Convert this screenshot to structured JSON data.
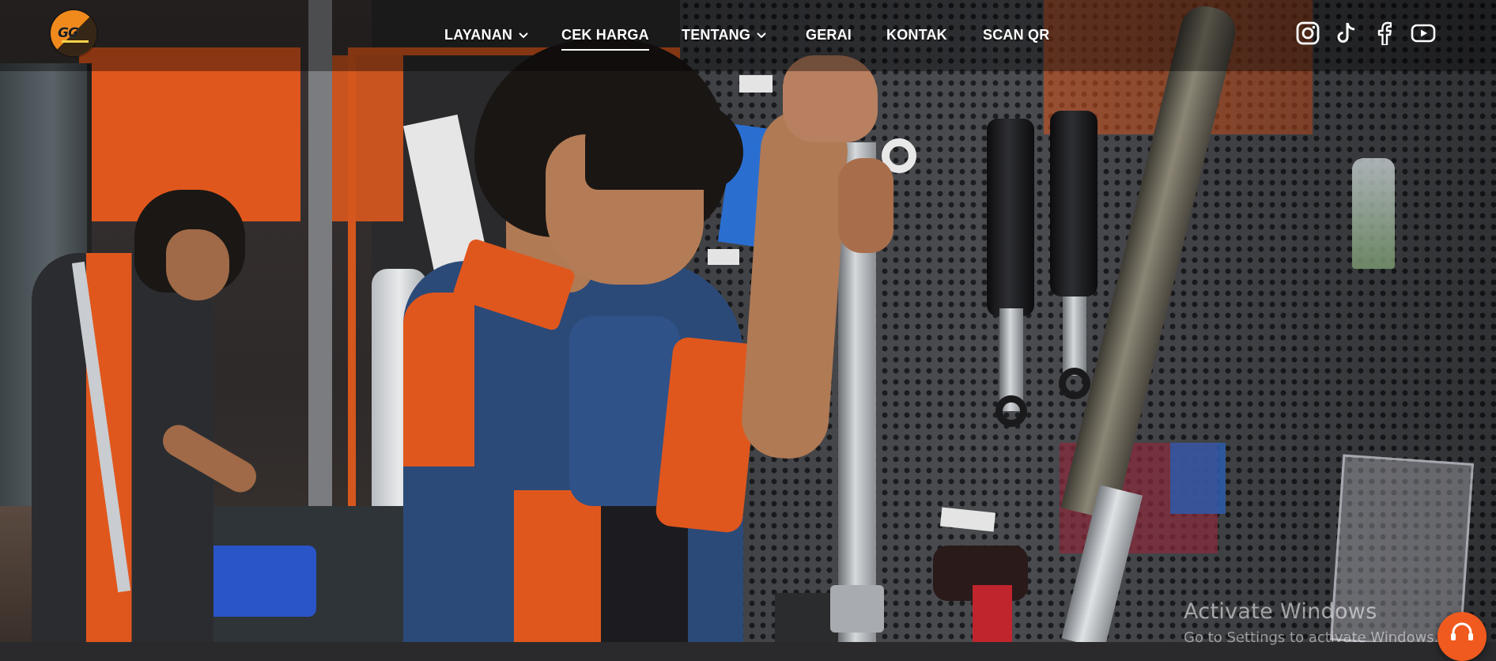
{
  "brand": {
    "logo_text": "GG",
    "logo_colors": {
      "primary": "#f08a1c",
      "secondary": "#1b1b1b"
    }
  },
  "nav": {
    "items": [
      {
        "label": "LAYANAN",
        "has_dropdown": true
      },
      {
        "label": "CEK HARGA",
        "has_dropdown": false,
        "active": true
      },
      {
        "label": "TENTANG",
        "has_dropdown": true
      },
      {
        "label": "GERAI",
        "has_dropdown": false
      },
      {
        "label": "KONTAK",
        "has_dropdown": false
      },
      {
        "label": "SCAN QR",
        "has_dropdown": false
      }
    ]
  },
  "social": {
    "icons": [
      "instagram-icon",
      "tiktok-icon",
      "facebook-icon",
      "youtube-icon"
    ]
  },
  "hero": {
    "background": "workshop photo — mechanics servicing motorcycle suspension",
    "accent_color": "#e0571d"
  },
  "system_overlay": {
    "watermark_title": "Activate Windows",
    "watermark_subtitle": "Go to Settings to activate Windows."
  },
  "chat_button": {
    "icon": "support-agent-icon",
    "color": "#f05a1e"
  }
}
